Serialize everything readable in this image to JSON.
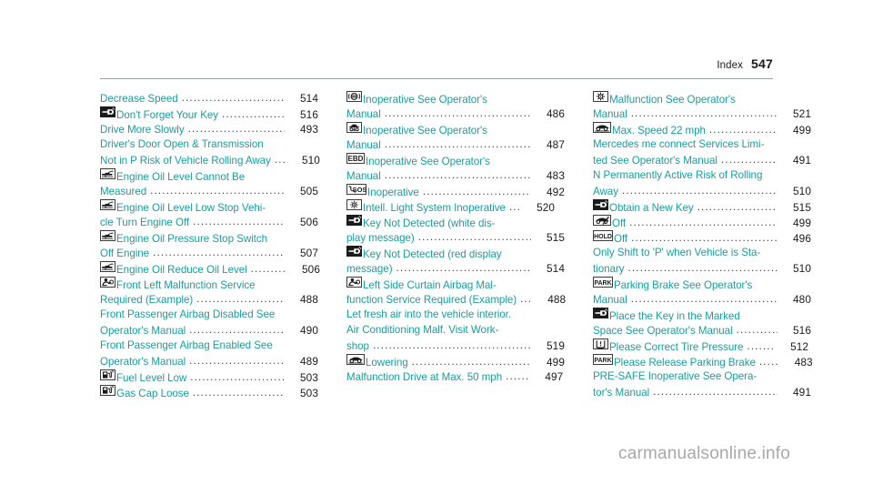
{
  "header": {
    "label": "Index",
    "page_number": "547"
  },
  "watermark": "carmanualsonline.info",
  "colors": {
    "entry_text": "#1a9d9d",
    "page_number": "#1a1a1a",
    "leader": "#3d3d3d",
    "rule": "#9aa0a3",
    "watermark": "#a8a8a8"
  },
  "columns": [
    {
      "id": "column-1",
      "lines": [
        {
          "icon": null,
          "text": "Decrease Speed",
          "leader": true,
          "page": "514"
        },
        {
          "icon": "key-icon",
          "text": "Don't Forget Your Key",
          "leader": true,
          "page": "516"
        },
        {
          "icon": null,
          "text": "Drive More Slowly",
          "leader": true,
          "page": "493"
        },
        {
          "icon": null,
          "text": "Driver's Door Open & Transmission",
          "leader": false,
          "page": ""
        },
        {
          "icon": null,
          "text": "Not in P Risk of Vehicle Rolling Away",
          "leader": true,
          "leader_short": "...",
          "page": "510"
        },
        {
          "icon": "oil-can-icon",
          "text": "Engine Oil Level Cannot Be",
          "leader": false,
          "page": ""
        },
        {
          "icon": null,
          "text": "Measured",
          "leader": true,
          "page": "505"
        },
        {
          "icon": "oil-can-icon",
          "text": "Engine Oil Level Low Stop Vehi-",
          "leader": false,
          "page": ""
        },
        {
          "icon": null,
          "text": "cle Turn Engine Off",
          "leader": true,
          "page": "506"
        },
        {
          "icon": "oil-can-icon",
          "text": "Engine Oil Pressure Stop Switch",
          "leader": false,
          "page": ""
        },
        {
          "icon": null,
          "text": "Off Engine",
          "leader": true,
          "page": "507"
        },
        {
          "icon": "oil-can-icon",
          "text": "Engine Oil Reduce Oil Level",
          "leader": true,
          "leader_short": ".........",
          "page": "506"
        },
        {
          "icon": "airbag-icon",
          "text": "Front Left Malfunction Service",
          "leader": false,
          "page": ""
        },
        {
          "icon": null,
          "text": "Required (Example)",
          "leader": true,
          "page": "488"
        },
        {
          "icon": null,
          "text": "Front Passenger Airbag Disabled See",
          "leader": false,
          "page": ""
        },
        {
          "icon": null,
          "text": "Operator's Manual",
          "leader": true,
          "page": "490"
        },
        {
          "icon": null,
          "text": "Front Passenger Airbag Enabled See",
          "leader": false,
          "page": ""
        },
        {
          "icon": null,
          "text": "Operator's Manual",
          "leader": true,
          "page": "489"
        },
        {
          "icon": "fuel-pump-icon",
          "text": "Fuel Level Low",
          "leader": true,
          "page": "503"
        },
        {
          "icon": "fuel-pump-icon",
          "text": "Gas Cap Loose",
          "leader": true,
          "page": "503"
        }
      ]
    },
    {
      "id": "column-2",
      "lines": [
        {
          "icon": "brake-disc-icon",
          "text": "Inoperative See Operator's",
          "leader": false,
          "page": ""
        },
        {
          "icon": null,
          "text": "Manual",
          "leader": true,
          "page": "486"
        },
        {
          "icon": "suspension-icon",
          "text": "Inoperative See Operator's",
          "leader": false,
          "page": ""
        },
        {
          "icon": null,
          "text": "Manual",
          "leader": true,
          "page": "487"
        },
        {
          "icon": "ebd-icon",
          "text": "Inoperative See Operator's",
          "leader": false,
          "page": ""
        },
        {
          "icon": null,
          "text": "Manual",
          "leader": true,
          "page": "483"
        },
        {
          "icon": "sos-icon",
          "text": "Inoperative",
          "leader": true,
          "page": "492"
        },
        {
          "icon": "headlight-icon",
          "text": "Intell. Light System Inoperative",
          "leader": true,
          "leader_short": "...",
          "page": "520"
        },
        {
          "icon": "key-icon",
          "text": "Key Not Detected  (white dis-",
          "leader": false,
          "page": ""
        },
        {
          "icon": null,
          "text": "play message)",
          "leader": true,
          "page": "515"
        },
        {
          "icon": "key-icon",
          "text": "Key Not Detected  (red display",
          "leader": false,
          "page": ""
        },
        {
          "icon": null,
          "text": "message)",
          "leader": true,
          "page": "514"
        },
        {
          "icon": "airbag-icon",
          "text": "Left Side Curtain Airbag Mal-",
          "leader": false,
          "page": ""
        },
        {
          "icon": null,
          "text": "function Service Required (Example)",
          "leader": true,
          "leader_short": "...",
          "page": "488"
        },
        {
          "icon": null,
          "text": "Let fresh air into the vehicle interior.",
          "leader": false,
          "page": ""
        },
        {
          "icon": null,
          "text": "Air Conditioning Malf. Visit Work-",
          "leader": false,
          "page": ""
        },
        {
          "icon": null,
          "text": "shop",
          "leader": true,
          "page": "519"
        },
        {
          "icon": "car-icon",
          "text": "Lowering",
          "leader": true,
          "page": "499"
        },
        {
          "icon": null,
          "text": "Malfunction Drive at Max. 50 mph",
          "leader": true,
          "leader_short": "......",
          "page": "497"
        }
      ]
    },
    {
      "id": "column-3",
      "lines": [
        {
          "icon": "engine-malfunction-icon",
          "text": "Malfunction See Operator's",
          "leader": false,
          "page": ""
        },
        {
          "icon": null,
          "text": "Manual",
          "leader": true,
          "page": "521"
        },
        {
          "icon": "car-icon",
          "text": "Max. Speed 22 mph",
          "leader": true,
          "page": "499"
        },
        {
          "icon": null,
          "text": "Mercedes me connect Services Limi-",
          "leader": false,
          "page": ""
        },
        {
          "icon": null,
          "text": "ted See Operator's Manual",
          "leader": true,
          "page": "491"
        },
        {
          "icon": null,
          "text": "N Permanently Active Risk of Rolling",
          "leader": false,
          "page": ""
        },
        {
          "icon": null,
          "text": "Away",
          "leader": true,
          "page": "510"
        },
        {
          "icon": "key-icon",
          "text": "Obtain a New Key",
          "leader": true,
          "page": "515"
        },
        {
          "icon": "car-off-icon",
          "text": "Off",
          "leader": true,
          "page": "499"
        },
        {
          "icon": "hold-icon",
          "text": "Off",
          "leader": true,
          "page": "496"
        },
        {
          "icon": null,
          "text": "Only Shift to 'P' when Vehicle is Sta-",
          "leader": false,
          "page": ""
        },
        {
          "icon": null,
          "text": "tionary",
          "leader": true,
          "page": "510"
        },
        {
          "icon": "park-icon",
          "text": "Parking Brake See Operator's",
          "leader": false,
          "page": ""
        },
        {
          "icon": null,
          "text": "Manual",
          "leader": true,
          "page": "480"
        },
        {
          "icon": "key-icon",
          "text": "Place the Key in the Marked",
          "leader": false,
          "page": ""
        },
        {
          "icon": null,
          "text": "Space See Operator's Manual",
          "leader": true,
          "page": "516"
        },
        {
          "icon": "tire-pressure-icon",
          "text": "Please Correct Tire Pressure",
          "leader": true,
          "leader_short": ".......",
          "page": "512"
        },
        {
          "icon": "park-icon",
          "text": "Please Release Parking Brake",
          "leader": true,
          "leader_short": ".....",
          "page": "483"
        },
        {
          "icon": null,
          "text": "PRE-SAFE Inoperative See Opera-",
          "leader": false,
          "page": ""
        },
        {
          "icon": null,
          "text": "tor's Manual",
          "leader": true,
          "page": "491"
        }
      ]
    }
  ]
}
